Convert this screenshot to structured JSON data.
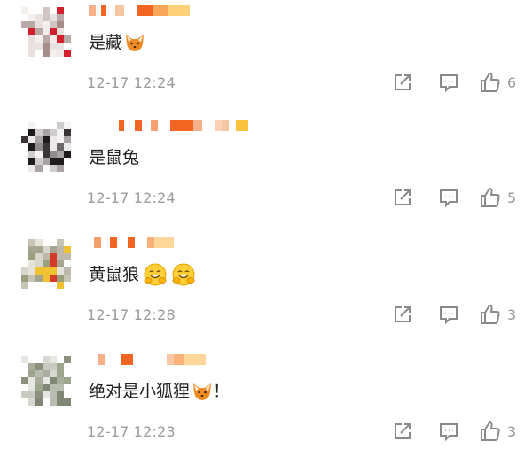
{
  "comments": [
    {
      "text": "是藏",
      "emoji": "fox-face-emoji",
      "time": "12-17 12:24",
      "likes": "6"
    },
    {
      "text": "是鼠兔",
      "emoji": "",
      "time": "12-17 12:24",
      "likes": "5"
    },
    {
      "text": "黄鼠狼",
      "emoji": "hugging-face-emoji",
      "time": "12-17 12:28",
      "likes": "3"
    },
    {
      "text": "绝对是小狐狸",
      "emoji": "fox-face-emoji",
      "suffix": "！",
      "time": "12-17 12:23",
      "likes": "3"
    }
  ],
  "icons": {
    "share": "share-icon",
    "reply": "comment-icon",
    "like": "thumbs-up-icon"
  },
  "colors": {
    "text": "#222222",
    "meta": "#9b9b9b",
    "icon": "#8a8a8a",
    "username_blur": "#f26522"
  }
}
